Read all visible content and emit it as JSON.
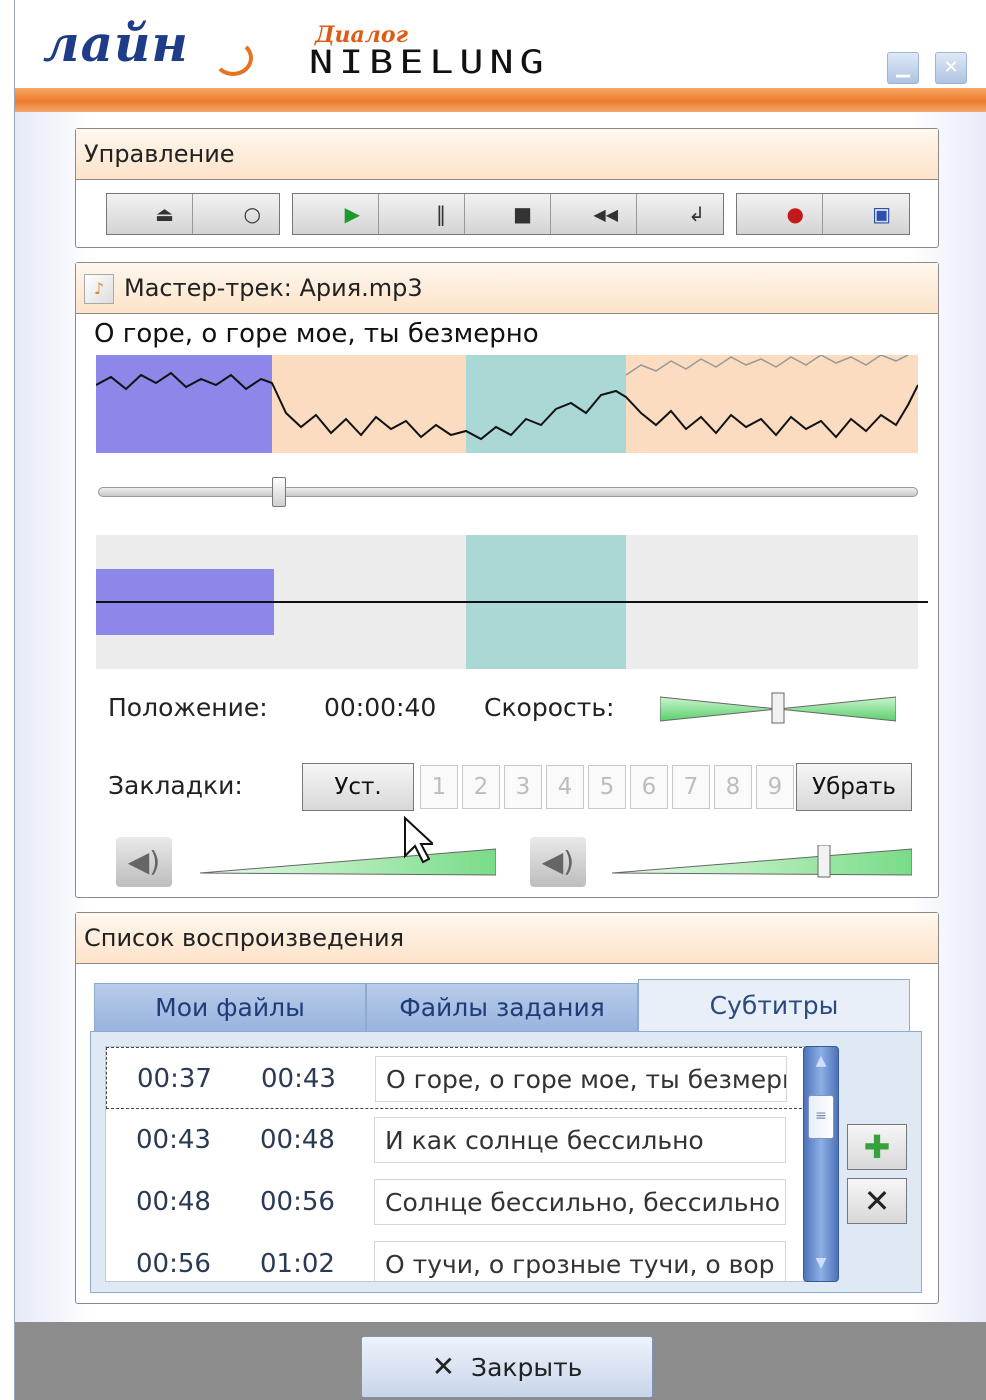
{
  "header": {
    "logo_main": "лайн",
    "logo_sub": "Диалог",
    "logo_brand": "NIBELUNG",
    "window_buttons": {
      "minimize_icon": "minimize-icon",
      "close_icon": "close-icon"
    }
  },
  "control": {
    "title": "Управление",
    "buttons": [
      {
        "icon": "eject-icon",
        "glyph": "⏏"
      },
      {
        "icon": "circle-icon",
        "glyph": "○"
      },
      {
        "icon": "play-icon",
        "glyph": "▶"
      },
      {
        "icon": "pause-icon",
        "glyph": "‖"
      },
      {
        "icon": "stop-icon",
        "glyph": "■"
      },
      {
        "icon": "rewind-icon",
        "glyph": "◀◀"
      },
      {
        "icon": "loop-icon",
        "glyph": "↲"
      },
      {
        "icon": "record-icon",
        "glyph": "●"
      },
      {
        "icon": "save-icon",
        "glyph": "▣"
      }
    ]
  },
  "master": {
    "title": "Мастер-трек: Ария.mp3",
    "lyric": "О горе, о горе мое, ты безмерно",
    "position_label": "Положение:",
    "position_value": "00:00:40",
    "speed_label": "Скорость:",
    "bookmarks_label": "Закладки:",
    "set_button": "Уст.",
    "bookmarks": [
      "1",
      "2",
      "3",
      "4",
      "5",
      "6",
      "7",
      "8",
      "9"
    ],
    "remove_button": "Убрать",
    "speed_level": 0.5,
    "volume_left_level": 1.0,
    "volume_right_level": 0.73,
    "seek_level": 0.22
  },
  "playlist": {
    "title": "Список воспроизведения",
    "tabs": [
      "Мои файлы",
      "Файлы задания",
      "Субтитры"
    ],
    "active_tab": 2,
    "rows": [
      {
        "start": "00:37",
        "end": "00:43",
        "text": "О горе, о горе мое, ты безмерно"
      },
      {
        "start": "00:43",
        "end": "00:48",
        "text": "И как солнце бессильно"
      },
      {
        "start": "00:48",
        "end": "00:56",
        "text": "Солнце бессильно, бессильно"
      },
      {
        "start": "00:56",
        "end": "01:02",
        "text": "О тучи, о грозные тучи, о вор"
      }
    ],
    "add_icon": "plus-icon",
    "delete_icon": "x-icon"
  },
  "footer": {
    "close_button": "Закрыть"
  },
  "colors": {
    "accent_orange": "#ee7a2c",
    "segment_blue": "#8c87e8",
    "segment_peach": "#fbdcc0",
    "segment_teal": "#a9d8d5",
    "slider_green": "#8fe59a"
  }
}
